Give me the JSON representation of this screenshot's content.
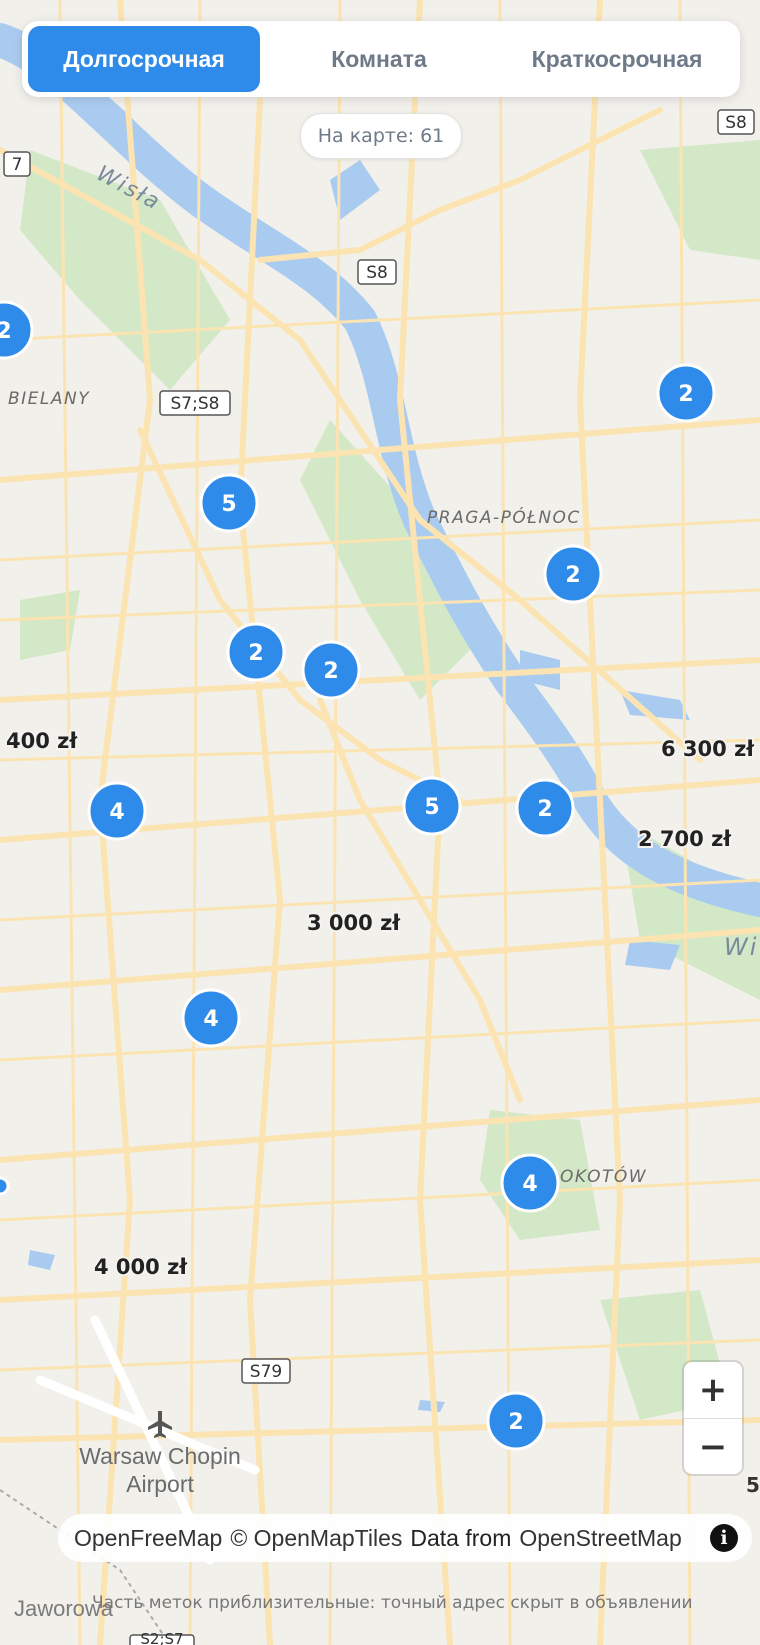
{
  "tabs": [
    {
      "label": "Долгосрочная",
      "active": true
    },
    {
      "label": "Комната",
      "active": false
    },
    {
      "label": "Краткосрочная",
      "active": false
    }
  ],
  "count_label": "На карте: 61",
  "clusters": [
    "2",
    "2",
    "5",
    "2",
    "2",
    "2",
    "4",
    "5",
    "2",
    "4",
    "4",
    "2"
  ],
  "price_labels": [
    "400 zł",
    "6 300 zł",
    "2 700 zł",
    "3 000 zł",
    "4 000 zł"
  ],
  "place_labels": {
    "bielany": "BIELANY",
    "praga": "PRAGA-PÓŁNOC",
    "mokotow": "OKOTÓW",
    "river": "Wisła",
    "river_right": "Wi",
    "airport_line1": "Warsaw Chopin",
    "airport_line2": "Airport",
    "jaworowa": "Jaworowa"
  },
  "road_shields": [
    "S8",
    "S8",
    "S7;S8",
    "S79",
    "7",
    "S2;S7"
  ],
  "edge_digit": "5",
  "zoom": {
    "in_label": "+",
    "out_label": "−"
  },
  "attribution": {
    "openfreemap": "OpenFreeMap",
    "openmaptiles": "© OpenMapTiles",
    "data_from": "Data from",
    "openstreetmap": "OpenStreetMap",
    "info_label": "i"
  },
  "footnote": "Часть меток приблизительные: точный адрес скрыт в объявлении",
  "colors": {
    "accent": "#2f8be9",
    "cluster": "#2f8be9",
    "water": "#aacbf0",
    "park": "#cfe5c4",
    "road": "#fbe4b1",
    "land": "#f2f0eb"
  }
}
